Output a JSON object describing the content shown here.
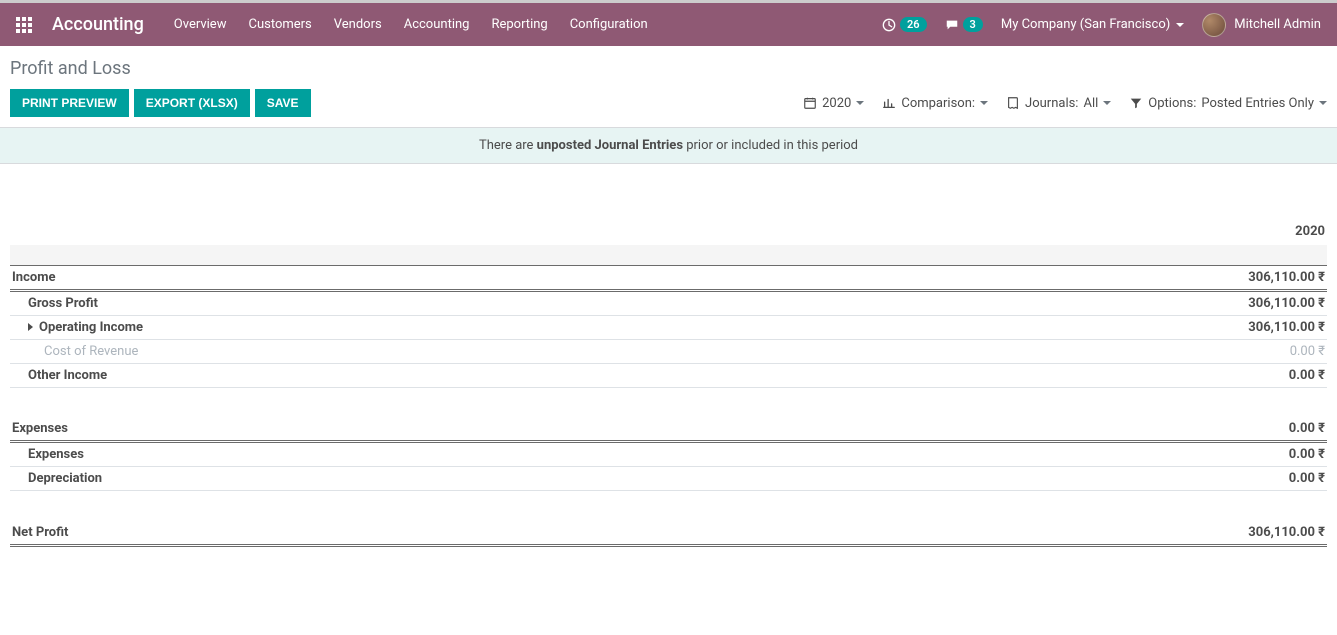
{
  "topbar": {
    "app_title": "Accounting",
    "menu": [
      "Overview",
      "Customers",
      "Vendors",
      "Accounting",
      "Reporting",
      "Configuration"
    ],
    "activity_badge": "26",
    "chat_badge": "3",
    "company": "My Company (San Francisco)",
    "user": "Mitchell Admin"
  },
  "page": {
    "title": "Profit and Loss",
    "buttons": {
      "print": "PRINT PREVIEW",
      "export": "EXPORT (XLSX)",
      "save": "SAVE"
    }
  },
  "filters": {
    "period": "2020",
    "comparison_label": "Comparison:",
    "journals_label": "Journals:",
    "journals_value": "All",
    "options_label": "Options:",
    "options_value": "Posted Entries Only"
  },
  "banner": {
    "prefix": "There are ",
    "link": "unposted Journal Entries",
    "suffix": " prior or included in this period"
  },
  "report": {
    "column_header": "2020",
    "rows": [
      {
        "type": "section",
        "label": "Income",
        "value": "306,110.00 ₹"
      },
      {
        "type": "line",
        "indent": 1,
        "bold": true,
        "label": "Gross Profit",
        "value": "306,110.00 ₹"
      },
      {
        "type": "line",
        "indent": 2,
        "bold": true,
        "expandable": true,
        "label": "Operating Income",
        "value": "306,110.00 ₹"
      },
      {
        "type": "line",
        "indent": 2,
        "muted": true,
        "label": "Cost of Revenue",
        "value": "0.00 ₹"
      },
      {
        "type": "line",
        "indent": 1,
        "bold": true,
        "label": "Other Income",
        "value": "0.00 ₹"
      },
      {
        "type": "gap"
      },
      {
        "type": "section",
        "label": "Expenses",
        "value": "0.00 ₹"
      },
      {
        "type": "line",
        "indent": 1,
        "bold": true,
        "label": "Expenses",
        "value": "0.00 ₹"
      },
      {
        "type": "line",
        "indent": 1,
        "bold": true,
        "label": "Depreciation",
        "value": "0.00 ₹"
      },
      {
        "type": "gap"
      },
      {
        "type": "section",
        "label": "Net Profit",
        "value": "306,110.00 ₹"
      }
    ]
  }
}
